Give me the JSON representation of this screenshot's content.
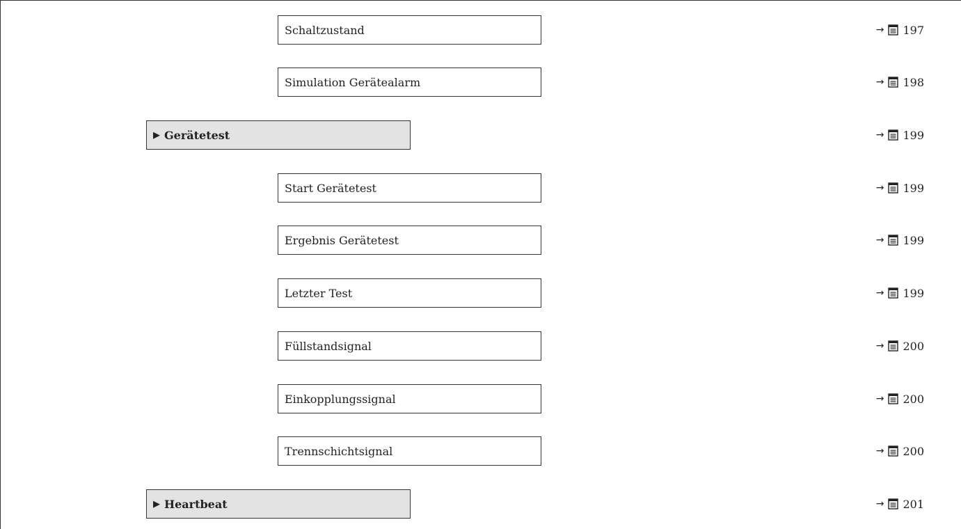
{
  "rows": [
    {
      "type": "param",
      "label": "Schaltzustand",
      "page": "197"
    },
    {
      "type": "param",
      "label": "Simulation Gerätealarm",
      "page": "198"
    },
    {
      "type": "submenu",
      "label": "Gerätetest",
      "page": "199"
    },
    {
      "type": "param",
      "label": "Start Gerätetest",
      "page": "199"
    },
    {
      "type": "param",
      "label": "Ergebnis Gerätetest",
      "page": "199"
    },
    {
      "type": "param",
      "label": "Letzter Test",
      "page": "199"
    },
    {
      "type": "param",
      "label": "Füllstandsignal",
      "page": "200"
    },
    {
      "type": "param",
      "label": "Einkopplungssignal",
      "page": "200"
    },
    {
      "type": "param",
      "label": "Trennschichtsignal",
      "page": "200"
    },
    {
      "type": "submenu",
      "label": "Heartbeat",
      "page": "201"
    }
  ],
  "symbols": {
    "arrow": "→",
    "submenu_marker": "▶",
    "page_icon": "book-page-icon"
  }
}
